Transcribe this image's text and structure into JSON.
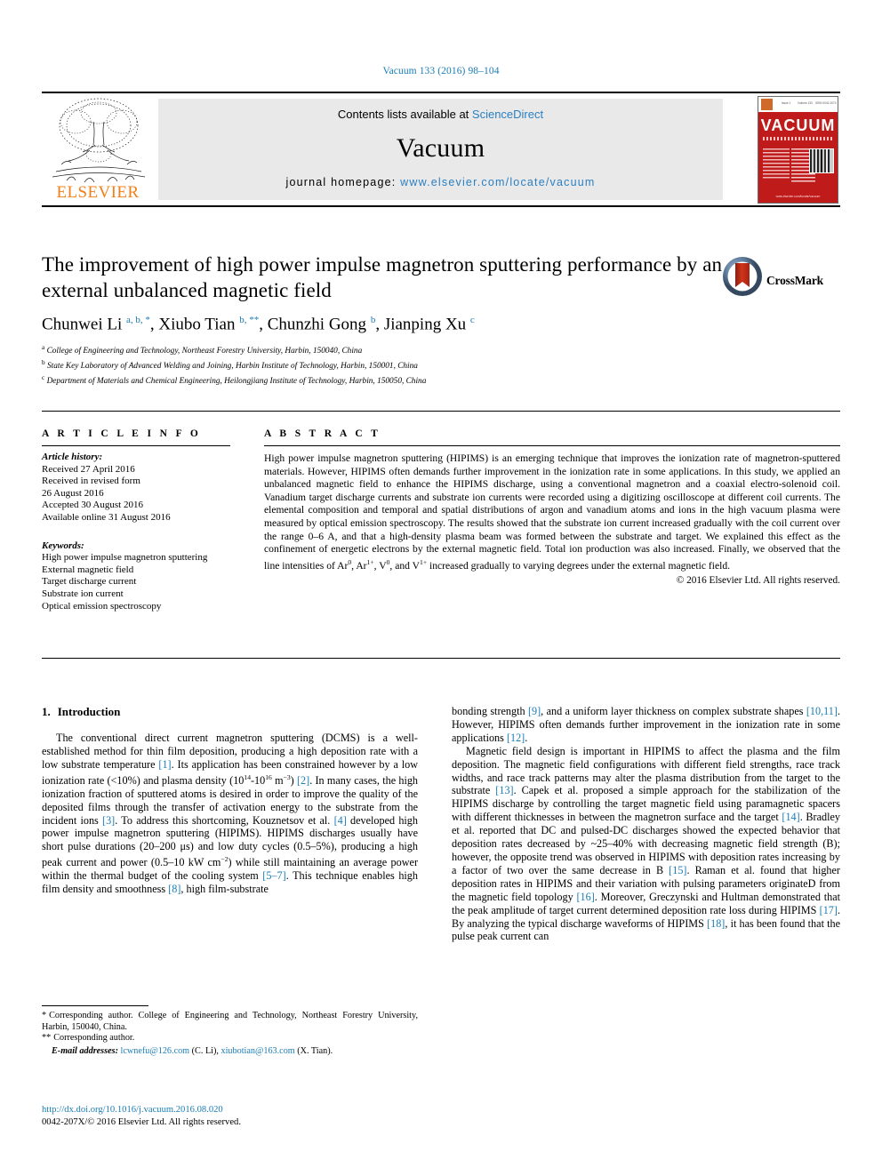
{
  "running_head": "Vacuum 133 (2016) 98–104",
  "masthead": {
    "publisher": "ELSEVIER",
    "contents_prefix": "Contents lists available at ",
    "contents_link": "ScienceDirect",
    "journal_name": "Vacuum",
    "homepage_prefix": "journal homepage: ",
    "homepage_url": "www.elsevier.com/locate/vacuum",
    "cover_title": "VACUUM",
    "cover_top_left": "Issue 1",
    "cover_top_mid": "Volume 133",
    "cover_top_right": "ISSN 0042-207X",
    "cover_bottom": "www.elsevier.com/locate/vacuum"
  },
  "article": {
    "title": "The improvement of high power impulse magnetron sputtering performance by an external unbalanced magnetic field",
    "authors": [
      {
        "name": "Chunwei Li",
        "marks": "a, b, *"
      },
      {
        "name": "Xiubo Tian",
        "marks": "b, **"
      },
      {
        "name": "Chunzhi Gong",
        "marks": "b"
      },
      {
        "name": "Jianping Xu",
        "marks": "c"
      }
    ],
    "affiliations": [
      {
        "mark": "a",
        "text": "College of Engineering and Technology, Northeast Forestry University, Harbin, 150040, China"
      },
      {
        "mark": "b",
        "text": "State Key Laboratory of Advanced Welding and Joining, Harbin Institute of Technology, Harbin, 150001, China"
      },
      {
        "mark": "c",
        "text": "Department of Materials and Chemical Engineering, Heilongjiang Institute of Technology, Harbin, 150050, China"
      }
    ],
    "crossmark_label": "CrossMark"
  },
  "article_info": {
    "heading": "A R T I C L E  I N F O",
    "history_label": "Article history:",
    "history": [
      "Received 27 April 2016",
      "Received in revised form",
      "26 August 2016",
      "Accepted 30 August 2016",
      "Available online 31 August 2016"
    ],
    "keywords_label": "Keywords:",
    "keywords": [
      "High power impulse magnetron sputtering",
      "External magnetic field",
      "Target discharge current",
      "Substrate ion current",
      "Optical emission spectroscopy"
    ]
  },
  "abstract": {
    "heading": "A B S T R A C T",
    "text_part1": "High power impulse magnetron sputtering (HIPIMS) is an emerging technique that improves the ionization rate of magnetron-sputtered materials. However, HIPIMS often demands further improvement in the ionization rate in some applications. In this study, we applied an unbalanced magnetic field to enhance the HIPIMS discharge, using a conventional magnetron and a coaxial electro-solenoid coil. Vanadium target discharge currents and substrate ion currents were recorded using a digitizing oscilloscope at different coil currents. The elemental composition and temporal and spatial distributions of argon and vanadium atoms and ions in the high vacuum plasma were measured by optical emission spectroscopy. The results showed that the substrate ion current increased gradually with the coil current over the range 0–6 A, and that a high-density plasma beam was formed between the substrate and target. We explained this effect as the confinement of energetic electrons by the external magnetic field. Total ion production was also increased. Finally, we observed that the line intensities of Ar",
    "sup1": "0",
    "mid1": ", Ar",
    "sup2": "1+",
    "mid2": ", V",
    "sup3": "0",
    "mid3": ", and V",
    "sup4": "1+",
    "text_part2": " increased gradually to varying degrees under the external magnetic field.",
    "copyright": "© 2016 Elsevier Ltd. All rights reserved."
  },
  "introduction": {
    "number": "1.",
    "heading": "Introduction",
    "left_paragraphs": [
      {
        "segments": [
          {
            "t": "The conventional direct current magnetron sputtering (DCMS) is a well-established method for thin film deposition, producing a high deposition rate with a low substrate temperature ",
            "k": "text"
          },
          {
            "t": "[1]",
            "k": "ref"
          },
          {
            "t": ". Its application has been constrained however by a low ionization rate (<10%) and plasma density (10",
            "k": "text"
          },
          {
            "t": "14",
            "k": "sup"
          },
          {
            "t": "-10",
            "k": "text"
          },
          {
            "t": "16",
            "k": "sup"
          },
          {
            "t": " m",
            "k": "text"
          },
          {
            "t": "−3",
            "k": "sup"
          },
          {
            "t": ") ",
            "k": "text"
          },
          {
            "t": "[2]",
            "k": "ref"
          },
          {
            "t": ". In many cases, the high ionization fraction of sputtered atoms is desired in order to improve the quality of the deposited films through the transfer of activation energy to the substrate from the incident ions ",
            "k": "text"
          },
          {
            "t": "[3]",
            "k": "ref"
          },
          {
            "t": ". To address this shortcoming, Kouznetsov et al. ",
            "k": "text"
          },
          {
            "t": "[4]",
            "k": "ref"
          },
          {
            "t": " developed high power impulse magnetron sputtering (HIPIMS). HIPIMS discharges usually have short pulse durations (20–200 μs) and low duty cycles (0.5–5%), producing a high peak current and power (0.5–10 kW cm",
            "k": "text"
          },
          {
            "t": "−2",
            "k": "sup"
          },
          {
            "t": ") while still maintaining an average power within the thermal budget of the cooling system ",
            "k": "text"
          },
          {
            "t": "[5–7]",
            "k": "ref"
          },
          {
            "t": ". This technique enables high film density and smoothness ",
            "k": "text"
          },
          {
            "t": "[8]",
            "k": "ref"
          },
          {
            "t": ", high film-substrate",
            "k": "text"
          }
        ]
      }
    ],
    "right_paragraphs": [
      {
        "indent": false,
        "segments": [
          {
            "t": "bonding strength ",
            "k": "text"
          },
          {
            "t": "[9]",
            "k": "ref"
          },
          {
            "t": ", and a uniform layer thickness on complex substrate shapes ",
            "k": "text"
          },
          {
            "t": "[10,11]",
            "k": "ref"
          },
          {
            "t": ". However, HIPIMS often demands further improvement in the ionization rate in some applications ",
            "k": "text"
          },
          {
            "t": "[12]",
            "k": "ref"
          },
          {
            "t": ".",
            "k": "text"
          }
        ]
      },
      {
        "indent": true,
        "segments": [
          {
            "t": "Magnetic field design is important in HIPIMS to affect the plasma and the film deposition. The magnetic field configurations with different field strengths, race track widths, and race track patterns may alter the plasma distribution from the target to the substrate ",
            "k": "text"
          },
          {
            "t": "[13]",
            "k": "ref"
          },
          {
            "t": ". Capek et al. proposed a simple approach for the stabilization of the HIPIMS discharge by controlling the target magnetic field using paramagnetic spacers with different thicknesses in between the magnetron surface and the target ",
            "k": "text"
          },
          {
            "t": "[14]",
            "k": "ref"
          },
          {
            "t": ". Bradley et al. reported that DC and pulsed-DC discharges showed the expected behavior that deposition rates decreased by ~25–40% with decreasing magnetic field strength (B); however, the opposite trend was observed in HIPIMS with deposition rates increasing by a factor of two over the same decrease in B ",
            "k": "text"
          },
          {
            "t": "[15]",
            "k": "ref"
          },
          {
            "t": ". Raman et al. found that higher deposition rates in HIPIMS and their variation with pulsing parameters originateD from the magnetic field topology ",
            "k": "text"
          },
          {
            "t": "[16]",
            "k": "ref"
          },
          {
            "t": ". Moreover, Greczynski and Hultman demonstrated that the peak amplitude of target current determined deposition rate loss during HIPIMS ",
            "k": "text"
          },
          {
            "t": "[17]",
            "k": "ref"
          },
          {
            "t": ". By analyzing the typical discharge waveforms of HIPIMS ",
            "k": "text"
          },
          {
            "t": "[18]",
            "k": "ref"
          },
          {
            "t": ", it has been found that the pulse peak current can",
            "k": "text"
          }
        ]
      }
    ]
  },
  "footnotes": {
    "corresponding_1_mark": "*",
    "corresponding_1": "Corresponding author. College of Engineering and Technology, Northeast Forestry University, Harbin, 150040, China.",
    "corresponding_2_mark": "**",
    "corresponding_2": "Corresponding author.",
    "email_label": "E-mail addresses:",
    "email_1": "lcwnefu@126.com",
    "email_1_who": "(C. Li),",
    "email_2": "xiubotian@163.com",
    "email_2_who": "(X. Tian)."
  },
  "doi": {
    "url": "http://dx.doi.org/10.1016/j.vacuum.2016.08.020",
    "issn_line": "0042-207X/© 2016 Elsevier Ltd. All rights reserved."
  },
  "colors": {
    "link": "#1a7db6",
    "sciencedirect": "#2a7fc1",
    "elsevier_orange": "#f07f1a",
    "cover_red": "#bf1b1b"
  }
}
